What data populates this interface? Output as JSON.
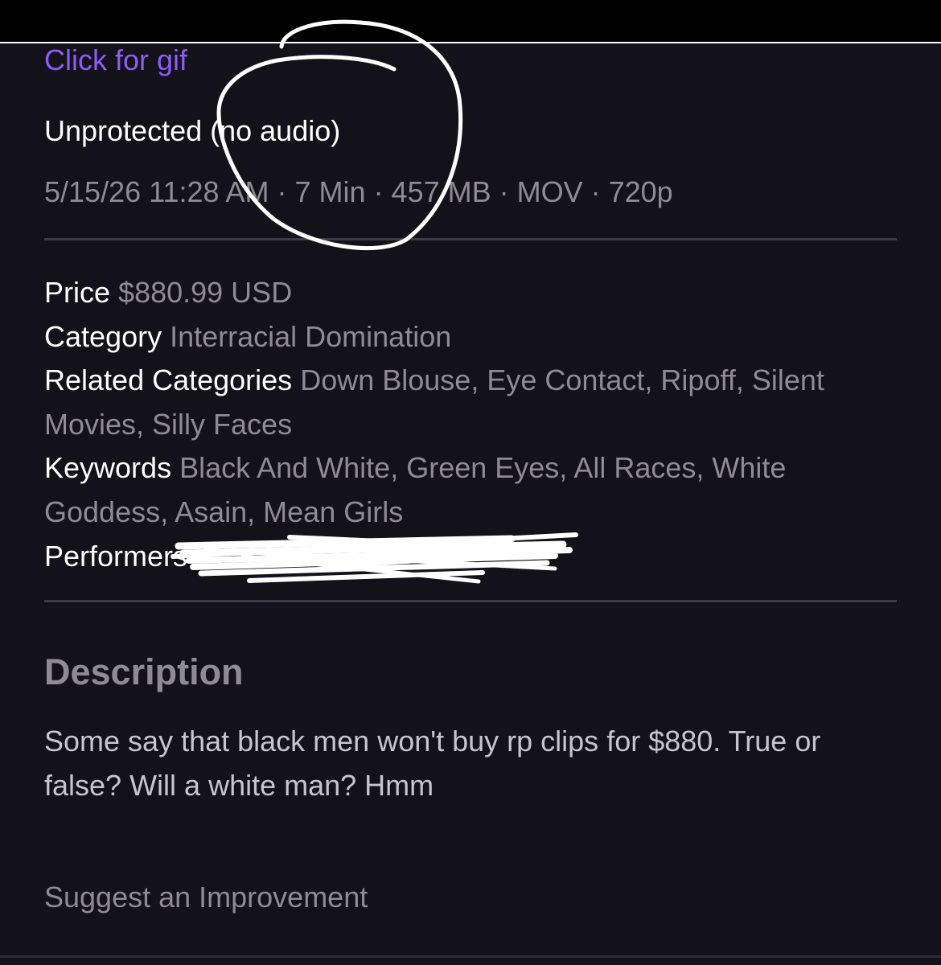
{
  "clip": {
    "gif_link_label": "Click for gif",
    "protection_status": "Unprotected (no audio)",
    "meta_line": "5/15/26 11:28 AM · 7 Min · 457 MB · MOV · 720p"
  },
  "details": {
    "price_label": "Price",
    "price_value": "$880.99 USD",
    "category_label": "Category",
    "category_value": "Interracial Domination",
    "related_label": "Related Categories",
    "related_value": "Down Blouse, Eye Contact, Ripoff, Silent Movies, Silly Faces",
    "keywords_label": "Keywords",
    "keywords_value": "Black And White, Green Eyes, All Races, White Goddess, Asain, Mean Girls",
    "performers_label": "Performers"
  },
  "description": {
    "heading": "Description",
    "text": "Some say that black men won't buy rp clips for $880. True or false? Will a white man? Hmm"
  },
  "footer": {
    "suggest_label": "Suggest an Improvement"
  },
  "colors": {
    "background": "#13111a",
    "link_accent": "#8c5cf5",
    "muted_text": "#8e8b95",
    "annotation_ink": "#ffffff"
  }
}
